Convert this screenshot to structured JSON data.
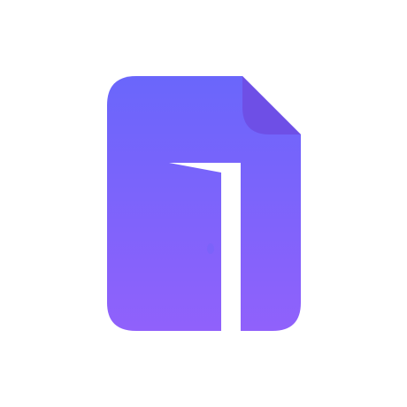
{
  "app_icon": {
    "name": "document-door-icon",
    "colors": {
      "background": "#ffffff",
      "gradient_top": "#6a66fb",
      "gradient_bottom": "#9061fb",
      "page_fold": "#6e4fe6",
      "door": "#ffffff",
      "knob": "#7b63fa"
    }
  }
}
